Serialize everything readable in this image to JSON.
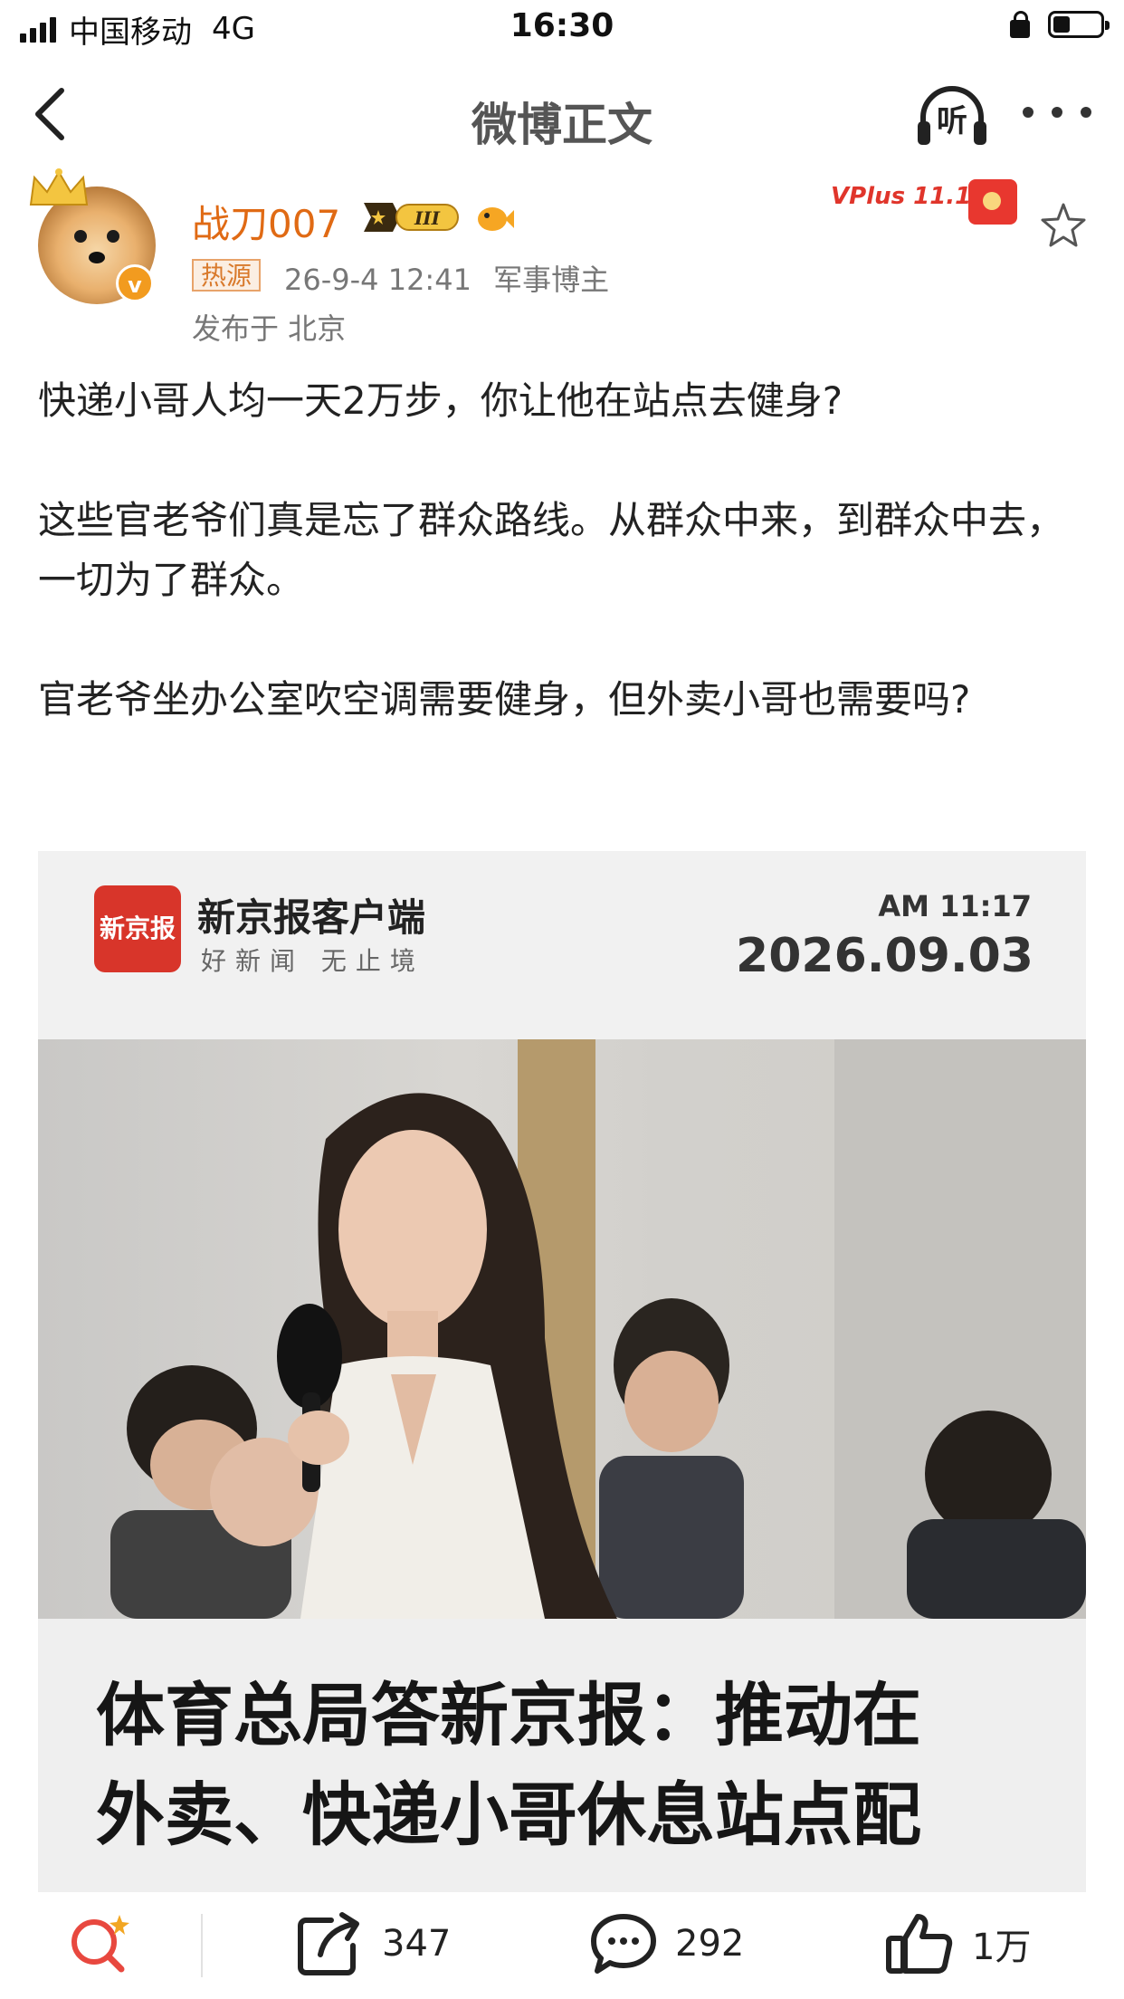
{
  "status_bar": {
    "carrier": "中国移动",
    "network": "4G",
    "time": "16:30",
    "battery_level": 0.35
  },
  "nav": {
    "title": "微博正文",
    "listen_label": "听"
  },
  "author": {
    "name": "战刀007",
    "vip_level": "III",
    "hot_tag": "热源",
    "timestamp": "26-9-4 12:41",
    "role": "军事博主",
    "location": "发布于 北京",
    "promo": "VPlus 11.11"
  },
  "post": {
    "paragraphs": [
      "快递小哥人均一天2万步，你让他在站点去健身?",
      "这些官老爷们真是忘了群众路线。从群众中来，到群众中去，一切为了群众。",
      "官老爷坐办公室吹空调需要健身，但外卖小哥也需要吗?"
    ]
  },
  "card": {
    "logo_text": "新京报",
    "source_name": "新京报客户端",
    "slogan": "好新闻 无止境",
    "time": "AM 11:17",
    "date": "2026.09.03",
    "headline_line1": "体育总局答新京报：推动在",
    "headline_line2": "外卖、快递小哥休息站点配"
  },
  "actions": {
    "share_count": "347",
    "comment_count": "292",
    "like_count": "1万"
  },
  "colors": {
    "username": "#e06a14",
    "logo_red": "#d8352a",
    "search_accent": "#e8483f"
  }
}
